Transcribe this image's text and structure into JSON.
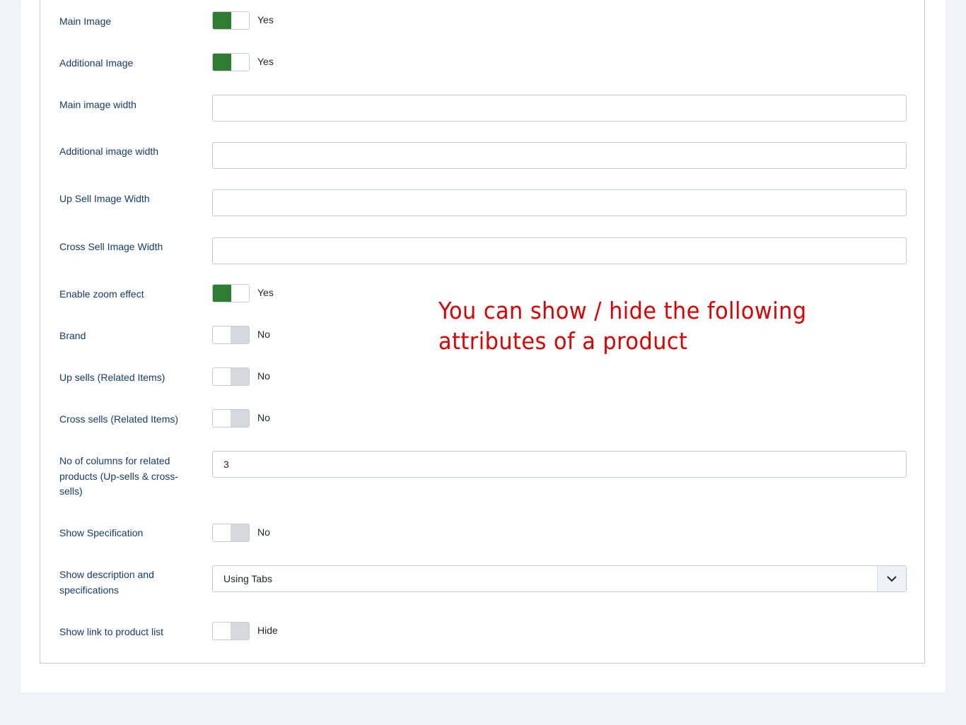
{
  "form": {
    "main_image": {
      "label": "Main Image",
      "state": "Yes"
    },
    "additional_image": {
      "label": "Additional Image",
      "state": "Yes"
    },
    "main_image_width": {
      "label": "Main image width",
      "value": ""
    },
    "additional_image_width": {
      "label": "Additional image width",
      "value": ""
    },
    "up_sell_image_width": {
      "label": "Up Sell Image Width",
      "value": ""
    },
    "cross_sell_image_width": {
      "label": "Cross Sell Image Width",
      "value": ""
    },
    "enable_zoom": {
      "label": "Enable zoom effect",
      "state": "Yes"
    },
    "brand": {
      "label": "Brand",
      "state": "No"
    },
    "up_sells": {
      "label": "Up sells (Related Items)",
      "state": "No"
    },
    "cross_sells": {
      "label": "Cross sells (Related Items)",
      "state": "No"
    },
    "related_columns": {
      "label": "No of columns for related products (Up-sells & cross-sells)",
      "value": "3"
    },
    "show_specification": {
      "label": "Show Specification",
      "state": "No"
    },
    "show_description": {
      "label": "Show description and specifications",
      "value": "Using Tabs"
    },
    "show_link": {
      "label": "Show link to product list",
      "state": "Hide"
    }
  },
  "annotation": {
    "text": "You can show / hide the following attributes of a product"
  },
  "icons": {
    "select_arrow": "chevron-down-icon"
  },
  "colors": {
    "toggle_on": "#2f7d32",
    "toggle_off": "#d5d8dc",
    "label": "#143c6c",
    "annotation": "#e00000"
  }
}
